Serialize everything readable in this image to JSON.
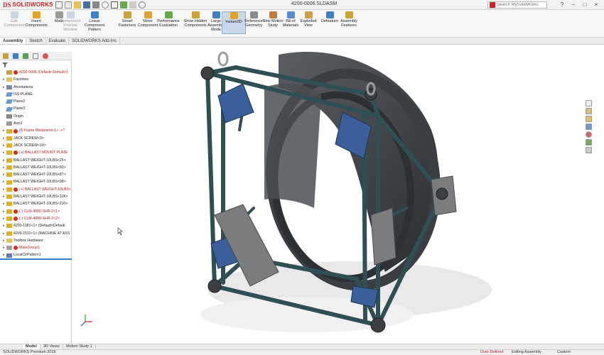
{
  "app": {
    "brand_prefix": "DS",
    "brand_name": "SOLIDWORKS",
    "document_title": "4200-0006.SLDASM",
    "search_placeholder": "Search MySolidWorks"
  },
  "command_manager": {
    "items": [
      {
        "label": "Edit Component",
        "state": "disabled",
        "icon_color": "#8aa0c0"
      },
      {
        "label": "Insert Components",
        "state": "normal",
        "icon_color": "#e3a32a"
      },
      {
        "label": "Mate",
        "state": "normal",
        "icon_color": "#9a9a9a"
      },
      {
        "label": "Component Preview Window",
        "state": "disabled",
        "icon_color": "#8aa0c0"
      },
      {
        "label": "Linear Component Pattern",
        "state": "normal",
        "icon_color": "#3f7fc4"
      },
      {
        "label": "Smart Fasteners",
        "state": "normal",
        "icon_color": "#c6a23a"
      },
      {
        "label": "Move Component",
        "state": "normal",
        "icon_color": "#e3a32a"
      },
      {
        "label": "Performance Evaluation",
        "state": "normal",
        "icon_color": "#6aa84f"
      },
      {
        "label": "Show Hidden Components",
        "state": "normal",
        "icon_color": "#c6a23a"
      },
      {
        "label": "Large Assembly Mode",
        "state": "normal",
        "icon_color": "#3f7fc4"
      },
      {
        "label": "Instant3D",
        "state": "active",
        "icon_color": "#e3a32a"
      },
      {
        "label": "Reference Geometry",
        "state": "normal",
        "icon_color": "#8a8a8a"
      },
      {
        "label": "New Motion Study",
        "state": "normal",
        "icon_color": "#c47a3a"
      },
      {
        "label": "Bill of Materials",
        "state": "normal",
        "icon_color": "#5a8ad0"
      },
      {
        "label": "Exploded View",
        "state": "normal",
        "icon_color": "#d0a040"
      },
      {
        "label": "Defeature",
        "state": "normal",
        "icon_color": "#3f7fc4"
      },
      {
        "label": "Assembly Features",
        "state": "normal",
        "icon_color": "#c6a23a"
      }
    ]
  },
  "tabs": [
    {
      "label": "Assembly",
      "active": true
    },
    {
      "label": "Sketch",
      "active": false
    },
    {
      "label": "Evaluate",
      "active": false
    },
    {
      "label": "SOLIDWORKS Add-Ins",
      "active": false
    }
  ],
  "tree": [
    {
      "label": "4200-0006 (Default<Default>)",
      "icon": "assembly-icon",
      "red": true,
      "warn": true,
      "expand": ""
    },
    {
      "label": "Favorites",
      "icon": "folder-icon",
      "red": false,
      "warn": false,
      "expand": "▸"
    },
    {
      "label": "Annotations",
      "icon": "annotation-icon",
      "red": false,
      "warn": false,
      "expand": "▸"
    },
    {
      "label": "ISS PLANE",
      "icon": "plane-icon",
      "red": false,
      "warn": false,
      "expand": ""
    },
    {
      "label": "Plane2",
      "icon": "plane-icon",
      "red": false,
      "warn": false,
      "expand": ""
    },
    {
      "label": "Plane3",
      "icon": "plane-icon",
      "red": false,
      "warn": false,
      "expand": ""
    },
    {
      "label": "Origin",
      "icon": "origin-icon",
      "red": false,
      "warn": false,
      "expand": ""
    },
    {
      "label": "Axis1",
      "icon": "axis-icon",
      "red": false,
      "warn": false,
      "expand": ""
    },
    {
      "label": "(f) Frame Weldment<1> ->?",
      "icon": "part-icon",
      "red": true,
      "warn": true,
      "expand": "▸"
    },
    {
      "label": "JACK SCREW<9>",
      "icon": "part-icon",
      "red": false,
      "warn": false,
      "expand": "▸"
    },
    {
      "label": "JACK SCREW<14>",
      "icon": "part-icon",
      "red": false,
      "warn": false,
      "expand": "▸"
    },
    {
      "label": "(+) BALLAST MOUNT PLATE",
      "icon": "part-icon",
      "red": true,
      "warn": true,
      "expand": "▸"
    },
    {
      "label": "BALLAST WEIGHT-10LBS<25>",
      "icon": "part-icon",
      "red": false,
      "warn": false,
      "expand": "▸"
    },
    {
      "label": "BALLAST WEIGHT-10LBS<83>",
      "icon": "part-icon",
      "red": false,
      "warn": false,
      "expand": "▸"
    },
    {
      "label": "BALLAST WEIGHT-10LBS<87>",
      "icon": "part-icon",
      "red": false,
      "warn": false,
      "expand": "▸"
    },
    {
      "label": "BALLAST WEIGHT-10LBS<98>",
      "icon": "part-icon",
      "red": false,
      "warn": false,
      "expand": "▸"
    },
    {
      "label": "(+) BALLAST WEIGHT-10LBS<",
      "icon": "part-icon",
      "red": true,
      "warn": true,
      "expand": "▸"
    },
    {
      "label": "BALLAST WEIGHT-10LBS<106>",
      "icon": "part-icon",
      "red": false,
      "warn": false,
      "expand": "▸"
    },
    {
      "label": "BALLAST WEIGHT-10LBS<110>",
      "icon": "part-icon",
      "red": false,
      "warn": false,
      "expand": "▸"
    },
    {
      "label": "(-) CLM-4000-SHR-2<1>",
      "icon": "part-icon",
      "red": true,
      "warn": true,
      "expand": "▸"
    },
    {
      "label": "(-) CLM-4000-SHR-2<2>",
      "icon": "part-icon",
      "red": true,
      "warn": true,
      "expand": "▸"
    },
    {
      "label": "4200-1181<1> (Default<Default",
      "icon": "part-icon",
      "red": false,
      "warn": false,
      "expand": "▸"
    },
    {
      "label": "4200-1511<1> (MACHINE AT ASS",
      "icon": "part-icon",
      "red": false,
      "warn": false,
      "expand": "▸"
    },
    {
      "label": "Toolbox Hardware",
      "icon": "folder-icon",
      "red": false,
      "warn": false,
      "expand": "▸"
    },
    {
      "label": "MateGroup1",
      "icon": "mate-icon",
      "red": true,
      "warn": true,
      "expand": "▸"
    },
    {
      "label": "LocalCirPattern1",
      "icon": "pattern-icon",
      "red": false,
      "warn": false,
      "expand": "▸"
    }
  ],
  "bottom_tabs": [
    {
      "label": "Model",
      "active": true
    },
    {
      "label": "3D Views",
      "active": false
    },
    {
      "label": "Motion Study 1",
      "active": false
    }
  ],
  "status": {
    "product": "SOLIDWORKS Premium 2019",
    "over_defined": "Over Defined",
    "editing_mode": "Editing Assembly",
    "units": "Custom"
  },
  "colors": {
    "brand_red": "#d61f26",
    "frame_teal": "#2f4f54",
    "solar_panel_blue": "#3a5f9a",
    "ring_dark": "#3b3f42"
  }
}
